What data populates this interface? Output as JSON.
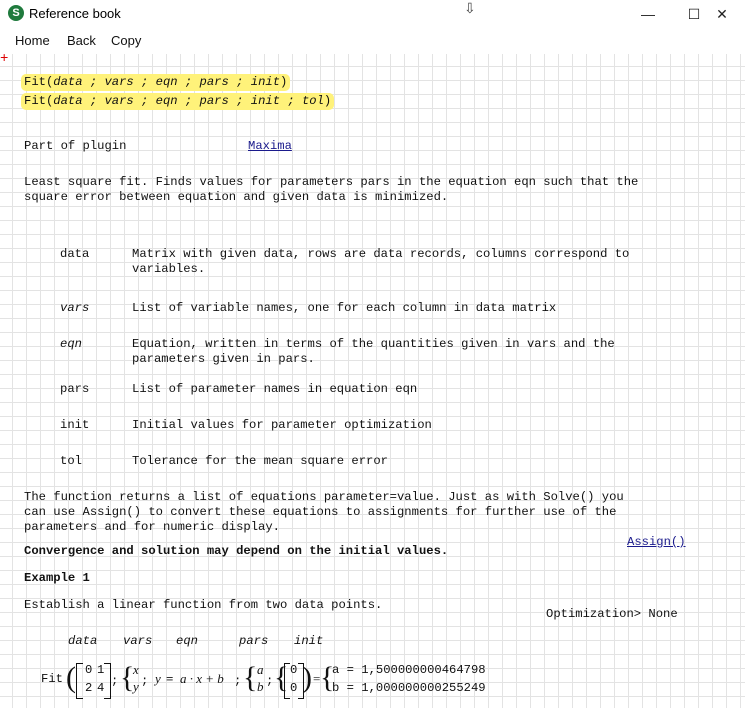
{
  "window": {
    "title": "Reference book",
    "minimize_glyph": "—",
    "maximize_glyph": "☐",
    "close_glyph": "✕"
  },
  "menu": {
    "home": "Home",
    "back": "Back",
    "copy": "Copy"
  },
  "content": {
    "signature1": {
      "fn": "Fit",
      "args": "data ; vars ; eqn ; pars ; init"
    },
    "signature2": {
      "fn": "Fit",
      "args": "data ; vars ; eqn ; pars ; init ; tol"
    },
    "plugin_label": "Part of plugin",
    "plugin_link": "Maxima",
    "desc_line1": "Least square fit. Finds values for parameters pars in the equation eqn such that the",
    "desc_line2": "square error between equation and given data is minimized.",
    "params": [
      {
        "name": "data",
        "desc": "Matrix with given data, rows are data records, columns correspond to variables."
      },
      {
        "name": "vars",
        "desc": "List of variable names, one for each column in data matrix"
      },
      {
        "name": "eqn",
        "desc": "Equation, written in terms of the quantities given in vars and the parameters given in pars."
      },
      {
        "name": "pars",
        "desc": "List of parameter names in equation eqn"
      },
      {
        "name": "init",
        "desc": "Initial values for parameter optimization"
      },
      {
        "name": "tol",
        "desc": "Tolerance for the mean square error"
      }
    ],
    "returns_line1": "The function returns a list of equations parameter=value. Just as with Solve() you",
    "returns_line2": "can use Assign() to convert these equations to assignments for further use of the",
    "returns_line3": "parameters and for numeric display.",
    "assign_link": "Assign()",
    "convergence": "Convergence and solution may depend on the initial values.",
    "example_title": "Example 1",
    "example_desc": "Establish a linear function from two data points.",
    "optimization": "Optimization> None",
    "example_headers": [
      "data",
      "vars",
      "eqn",
      "pars",
      "init"
    ],
    "example": {
      "fn": "Fit",
      "matrix": [
        "0",
        "1",
        "2",
        "4"
      ],
      "vars": [
        "x",
        "y"
      ],
      "eqn_lhs": "y",
      "eqn_rhs": "a · x + b",
      "pars": [
        "a",
        "b"
      ],
      "init": [
        "0",
        "0"
      ],
      "result": [
        "a = 1,500000000464798",
        "b = 1,000000000255249"
      ]
    }
  }
}
